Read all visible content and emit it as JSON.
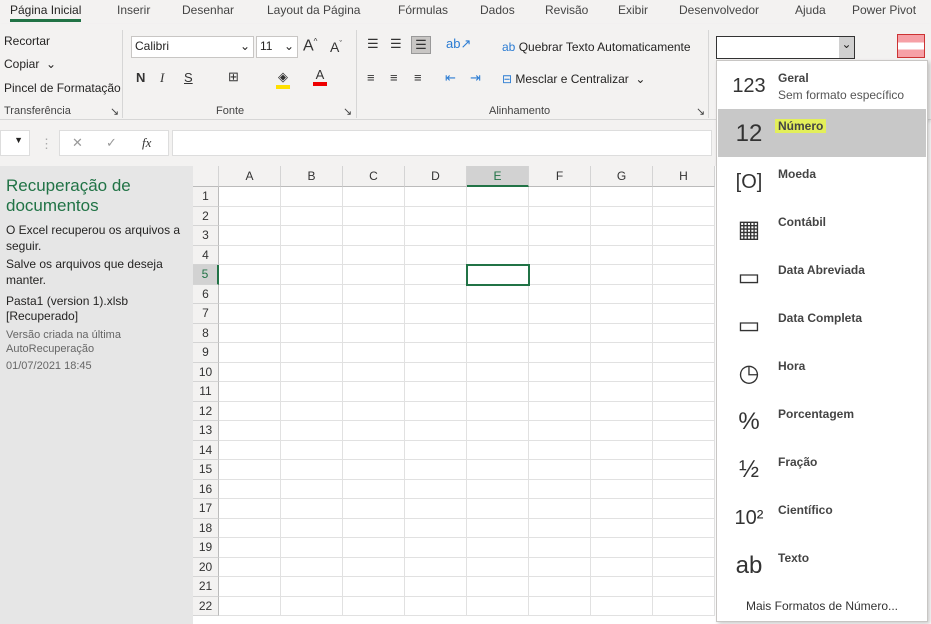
{
  "tabs": [
    "Página Inicial",
    "Inserir",
    "Desenhar",
    "Layout da Página",
    "Fórmulas",
    "Dados",
    "Revisão",
    "Exibir",
    "Desenvolvedor",
    "Ajuda",
    "Power Pivot"
  ],
  "clipboard": {
    "cut": "Recortar",
    "copy": "Copiar",
    "painter": "Pincel de Formatação",
    "group": "Transferência"
  },
  "font": {
    "name": "Calibri",
    "size": "11",
    "bold": "N",
    "italic": "I",
    "underline": "S",
    "group": "Fonte"
  },
  "alignment": {
    "wrap": "Quebrar Texto Automaticamente",
    "merge": "Mesclar e Centralizar",
    "group": "Alinhamento"
  },
  "number_format_value": "",
  "formula_bar": {
    "fx": "fx",
    "cancel": "✕",
    "enter": "✓"
  },
  "recovery": {
    "title": "Recuperação de documentos",
    "line1": "O Excel recuperou os arquivos a seguir.",
    "line2": "Salve os arquivos que deseja manter.",
    "file": "Pasta1 (version 1).xlsb  [Recuperado]",
    "desc": "Versão criada na última AutoRecuperação",
    "date": "01/07/2021 18:45"
  },
  "columns": [
    "A",
    "B",
    "C",
    "D",
    "E",
    "F",
    "G",
    "H"
  ],
  "rows": [
    "1",
    "2",
    "3",
    "4",
    "5",
    "6",
    "7",
    "8",
    "9",
    "10",
    "11",
    "12",
    "13",
    "14",
    "15",
    "16",
    "17",
    "18",
    "19",
    "20",
    "21",
    "22"
  ],
  "selected_cell": "E5",
  "accent": "#217346",
  "menu": {
    "items": [
      {
        "label": "Geral",
        "sub": "Sem formato específico",
        "icon": "clock-123-icon",
        "glyph": "123"
      },
      {
        "label": "Número",
        "icon": "number-icon",
        "glyph": "12",
        "selected": true
      },
      {
        "label": "Moeda",
        "icon": "currency-icon",
        "glyph": "[O]"
      },
      {
        "label": "Contábil",
        "icon": "accounting-icon",
        "glyph": "▦"
      },
      {
        "label": "Data Abreviada",
        "icon": "calendar-short-icon",
        "glyph": "▭"
      },
      {
        "label": "Data Completa",
        "icon": "calendar-long-icon",
        "glyph": "▭"
      },
      {
        "label": "Hora",
        "icon": "clock-icon",
        "glyph": "◷"
      },
      {
        "label": "Porcentagem",
        "icon": "percent-icon",
        "glyph": "%"
      },
      {
        "label": "Fração",
        "icon": "fraction-icon",
        "glyph": "½"
      },
      {
        "label": "Científico",
        "icon": "scientific-icon",
        "glyph": "10²"
      },
      {
        "label": "Texto",
        "icon": "text-icon",
        "glyph": "ab"
      }
    ],
    "more": "Mais Formatos de Número..."
  }
}
